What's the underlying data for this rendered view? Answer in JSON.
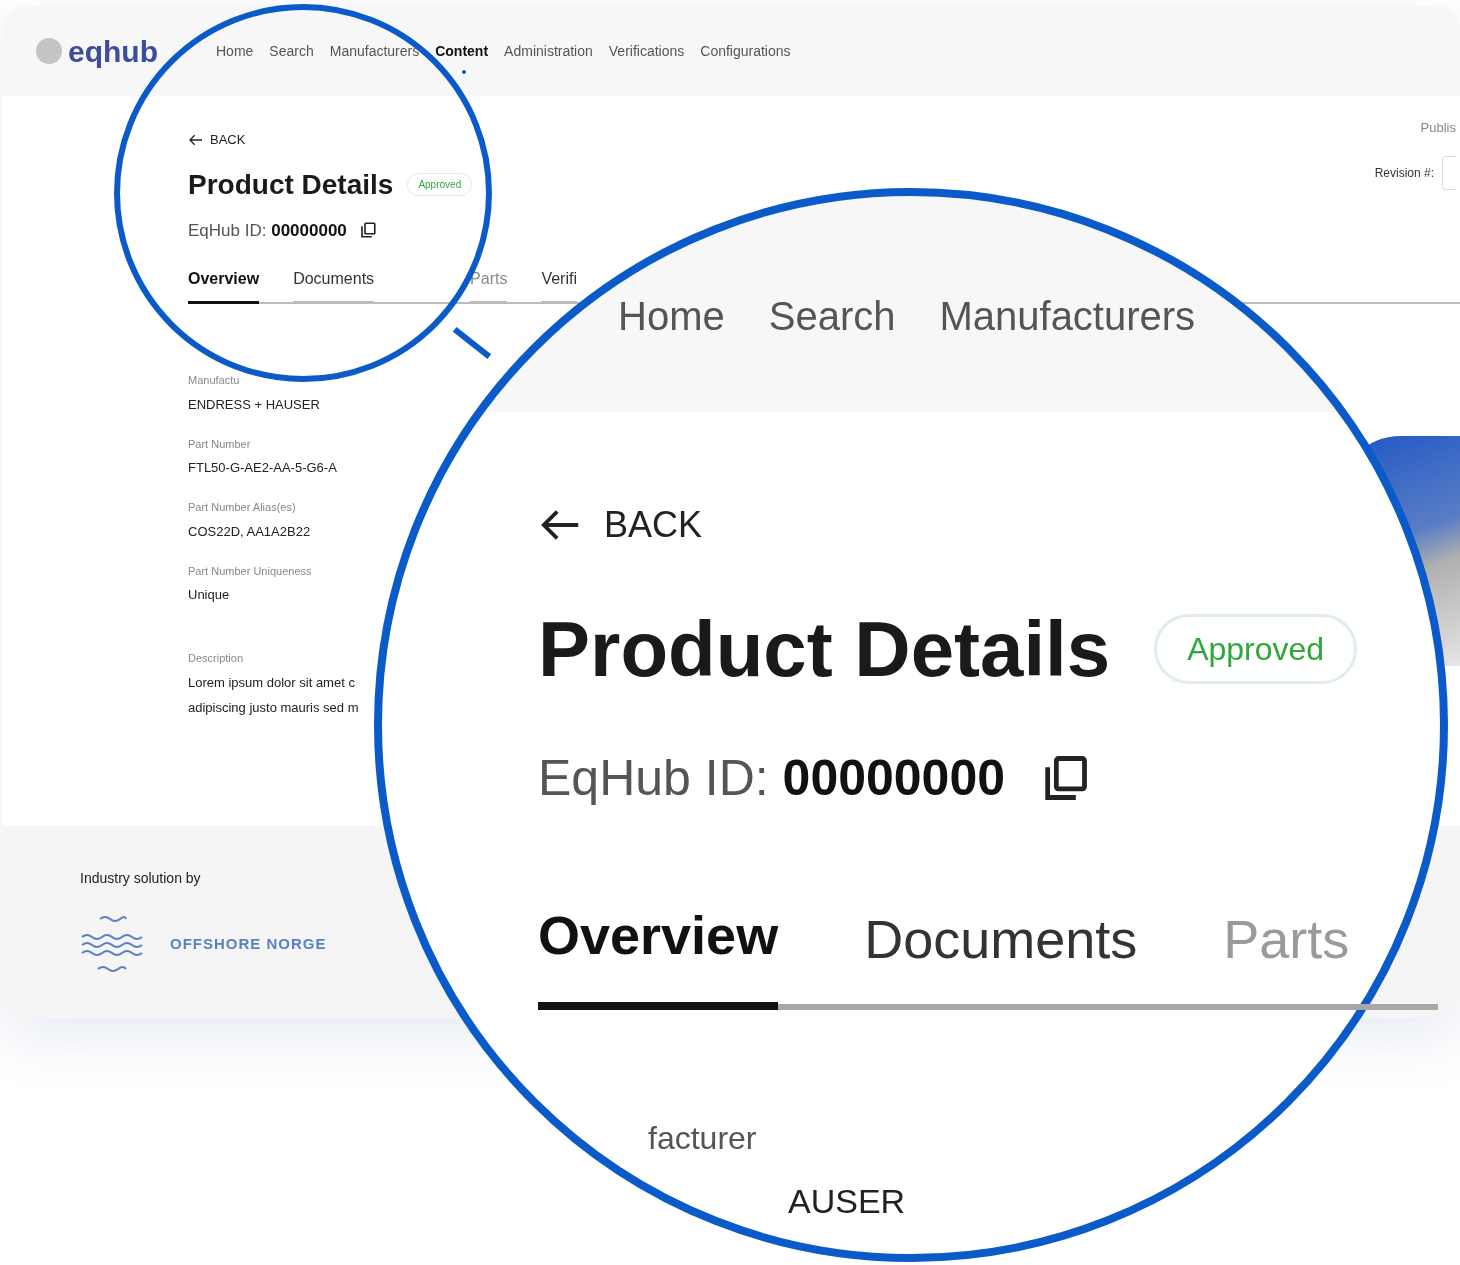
{
  "header": {
    "logo": "eqhub",
    "nav": [
      {
        "label": "Home",
        "selected": false
      },
      {
        "label": "Search",
        "selected": false
      },
      {
        "label": "Manufacturers",
        "selected": false
      },
      {
        "label": "Content",
        "selected": true
      },
      {
        "label": "Administration",
        "selected": false
      },
      {
        "label": "Verifications",
        "selected": false
      },
      {
        "label": "Configurations",
        "selected": false
      }
    ]
  },
  "page": {
    "back": "BACK",
    "title": "Product Details",
    "status": "Approved",
    "id_label": "EqHub ID:",
    "id_value": "00000000",
    "publish": "Publis",
    "revision_label": "Revision #:",
    "tabs": [
      {
        "label": "Overview",
        "selected": true,
        "disabled": false
      },
      {
        "label": "Documents",
        "selected": false,
        "disabled": false
      },
      {
        "label": "Parts",
        "selected": false,
        "disabled": true
      },
      {
        "label": "Verifi",
        "selected": false,
        "disabled": false
      }
    ],
    "fields": [
      {
        "label": "Manufactu",
        "lines": [
          "ENDRESS + HAUSER"
        ]
      },
      {
        "label": "Part Number",
        "lines": [
          "FTL50-G-AE2-AA-5-G6-A"
        ]
      },
      {
        "label": "Part Number Alias(es)",
        "lines": [
          "COS22D, AA1A2B22"
        ]
      },
      {
        "label": "Part Number Uniqueness",
        "lines": [
          "Unique"
        ]
      },
      {
        "label": "Description",
        "lines": [
          "Lorem ipsum dolor sit amet c",
          "adipiscing justo mauris sed m"
        ]
      }
    ]
  },
  "footer": {
    "caption": "Industry solution by",
    "partner": "OFFSHORE NORGE"
  },
  "magnifier": {
    "nav": [
      "Home",
      "Search",
      "Manufacturers"
    ],
    "back": "BACK",
    "title": "Product Details",
    "status": "Approved",
    "id_label": "EqHub ID:",
    "id_value": "00000000",
    "tabs": [
      {
        "label": "Overview",
        "selected": true,
        "disabled": false
      },
      {
        "label": "Documents",
        "selected": false,
        "disabled": false
      },
      {
        "label": "Parts",
        "selected": false,
        "disabled": true
      }
    ],
    "field_label": "facturer",
    "field_value": "AUSER"
  }
}
